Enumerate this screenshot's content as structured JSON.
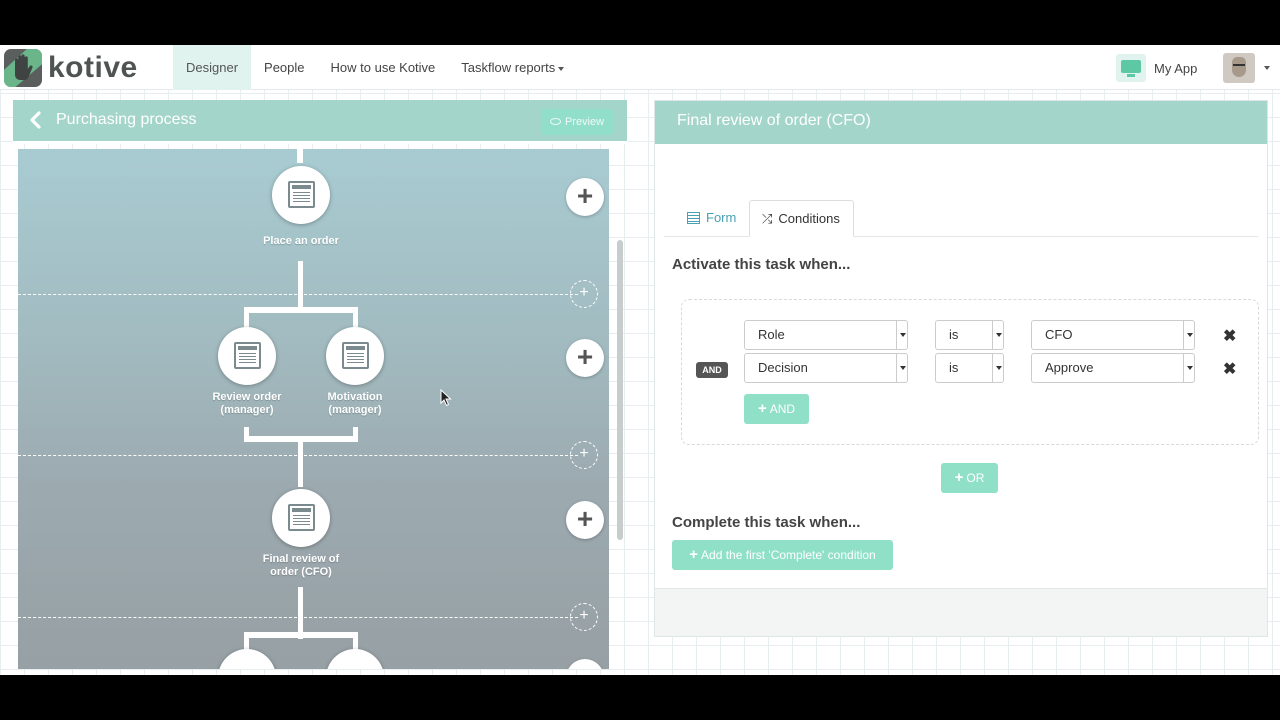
{
  "brand": {
    "name": "kotive"
  },
  "nav": {
    "items": [
      {
        "label": "Designer",
        "active": true
      },
      {
        "label": "People"
      },
      {
        "label": "How to use Kotive"
      },
      {
        "label": "Taskflow reports"
      }
    ],
    "my_app": "My App"
  },
  "designer": {
    "title": "Purchasing process",
    "preview_label": "Preview",
    "nodes": [
      {
        "label": "Place an order"
      },
      {
        "label": "Review order (manager)",
        "lines": [
          "Review order",
          "(manager)"
        ]
      },
      {
        "label": "Motivation (manager)",
        "lines": [
          "Motivation",
          "(manager)"
        ]
      },
      {
        "label": "Final review of order (CFO)",
        "lines": [
          "Final review of",
          "order (CFO)"
        ]
      }
    ]
  },
  "task_panel": {
    "title": "Final review of order (CFO)",
    "tabs": [
      {
        "label": "Form"
      },
      {
        "label": "Conditions",
        "active": true
      }
    ],
    "activate_heading": "Activate this task when...",
    "and_badge": "AND",
    "conditions": [
      {
        "field": "Role",
        "operator": "is",
        "value": "CFO"
      },
      {
        "field": "Decision",
        "operator": "is",
        "value": "Approve"
      }
    ],
    "add_and_label": "AND",
    "add_or_label": "OR",
    "complete_heading": "Complete this task when...",
    "add_complete_label": "Add the first 'Complete' condition"
  },
  "colors": {
    "header": "#a3d5ca",
    "accent": "#8fe0c6",
    "link": "#4aa0b5"
  }
}
